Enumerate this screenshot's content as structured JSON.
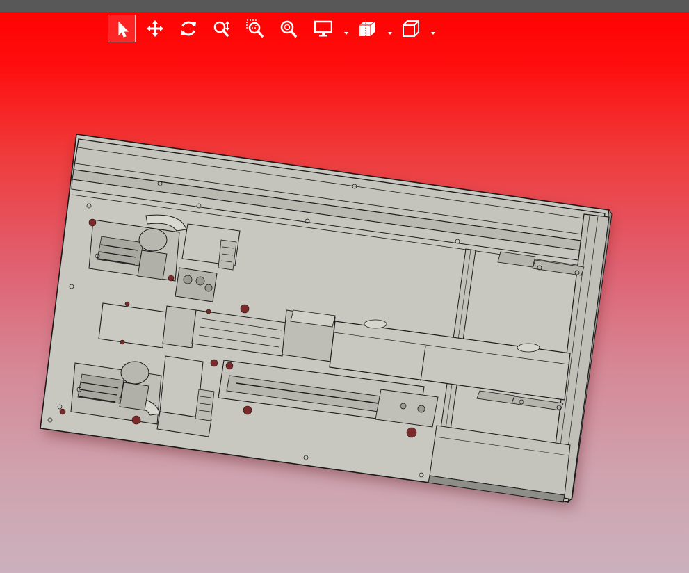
{
  "toolbar": {
    "tools": [
      {
        "id": "select",
        "icon": "cursor-arrow-icon",
        "active": true
      },
      {
        "id": "pan",
        "icon": "move-arrows-icon",
        "active": false
      },
      {
        "id": "rotate",
        "icon": "rotate-icon",
        "active": false
      },
      {
        "id": "zoom-in-out",
        "icon": "zoom-updown-icon",
        "active": false
      },
      {
        "id": "zoom-window",
        "icon": "zoom-window-icon",
        "active": false
      },
      {
        "id": "zoom-fit",
        "icon": "zoom-fit-icon",
        "active": false
      },
      {
        "id": "display-style",
        "icon": "monitor-icon",
        "active": false,
        "dropdown": true
      },
      {
        "id": "section-view",
        "icon": "section-view-icon",
        "active": false,
        "dropdown": true
      },
      {
        "id": "view-orientation",
        "icon": "cube-view-icon",
        "active": false,
        "dropdown": true
      }
    ]
  },
  "colors": {
    "titlebar": "#585858",
    "background_top": "#ff0000",
    "background_bottom": "#cbb1bd",
    "model_face": "#c8c8c0",
    "model_edge": "#1a1a1a",
    "model_hole": "#7a2a2a"
  }
}
